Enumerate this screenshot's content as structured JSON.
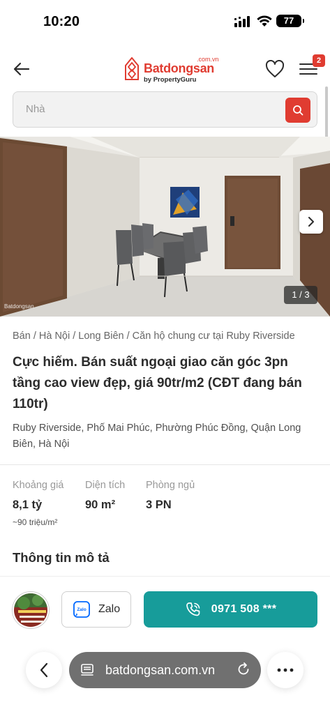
{
  "status_bar": {
    "time": "10:20",
    "battery": "77"
  },
  "header": {
    "logo_name": "Batdongsan",
    "logo_domain": ".com.vn",
    "logo_sub": "by PropertyGuru",
    "menu_badge": "2"
  },
  "search": {
    "placeholder": "Nhà"
  },
  "photo": {
    "counter": "1 / 3",
    "watermark": "Batdongsan"
  },
  "listing": {
    "breadcrumb": "Bán / Hà Nội / Long Biên / Căn hộ chung cư tại Ruby Riverside",
    "title": "Cực hiếm. Bán suất ngoại giao căn góc 3pn tầng cao view đẹp, giá 90tr/m2 (CĐT đang bán 110tr)",
    "address": "Ruby Riverside, Phố Mai Phúc, Phường Phúc Đồng, Quận Long Biên, Hà Nội",
    "stats": {
      "price": {
        "label": "Khoảng giá",
        "value": "8,1 tỷ",
        "sub": "~90 triệu/m²"
      },
      "area": {
        "label": "Diện tích",
        "value": "90 m²"
      },
      "bedrooms": {
        "label": "Phòng ngủ",
        "value": "3 PN"
      }
    },
    "description_heading": "Thông tin mô tả"
  },
  "contact": {
    "zalo_label": "Zalo",
    "phone_label": "0971 508 ***",
    "accent_color": "#179c9a"
  },
  "browser": {
    "url": "batdongsan.com.vn"
  },
  "colors": {
    "brand": "#e03c31",
    "text": "#2c2c2c",
    "muted": "#999999"
  }
}
